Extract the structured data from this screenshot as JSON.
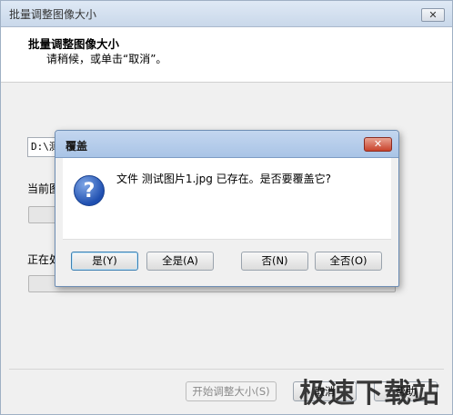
{
  "window": {
    "title": "批量调整图像大小",
    "close_glyph": "✕"
  },
  "header": {
    "title": "批量调整图像大小",
    "subtitle": "请稍候，或单击“取消”。"
  },
  "main": {
    "path_text": "D:\\测",
    "current_label": "当前图",
    "processing_label": "正在处"
  },
  "footer": {
    "start_label": "开始调整大小(S)",
    "cancel_label": "取消",
    "help_label": "帮助"
  },
  "watermark": "极速下载站",
  "dialog": {
    "title": "覆盖",
    "close_glyph": "✕",
    "icon": "question-icon",
    "icon_glyph": "?",
    "message": "文件 测试图片1.jpg 已存在。是否要覆盖它?",
    "buttons": {
      "yes": "是(Y)",
      "yes_all": "全是(A)",
      "no": "否(N)",
      "no_all": "全否(O)"
    }
  }
}
